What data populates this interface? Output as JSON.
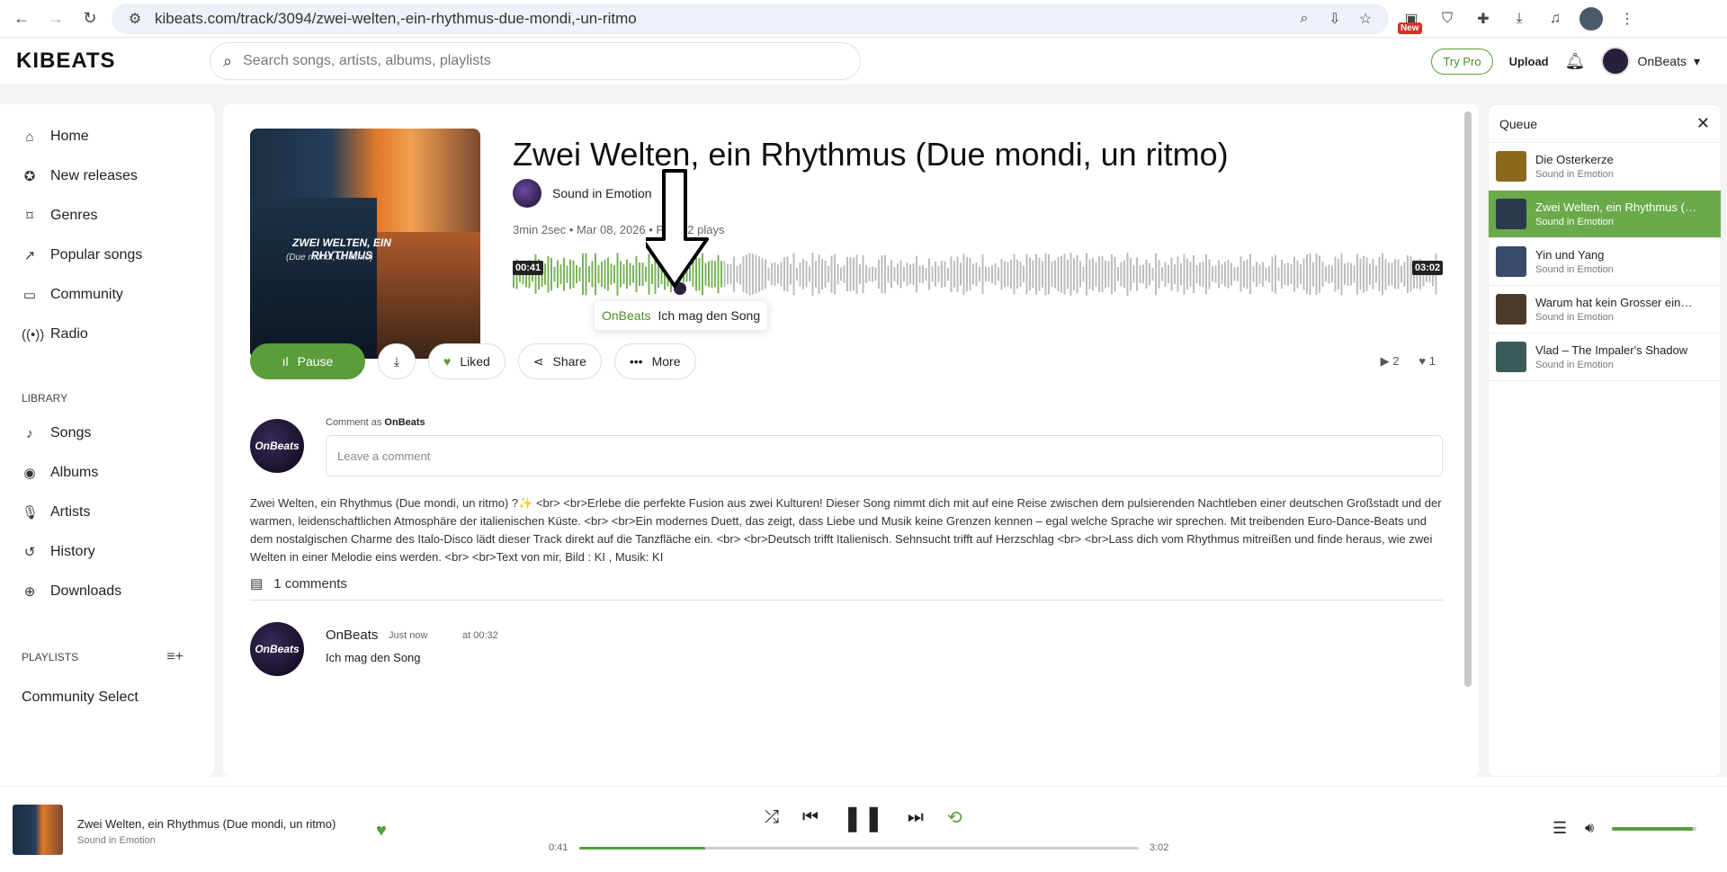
{
  "browser": {
    "url": "kibeats.com/track/3094/zwei-welten,-ein-rhythmus-due-mondi,-un-ritmo",
    "new_badge": "New"
  },
  "header": {
    "logo": "KIBEATS",
    "search_placeholder": "Search songs, artists, albums, playlists",
    "try_pro": "Try Pro",
    "upload": "Upload",
    "user": "OnBeats"
  },
  "sidebar": {
    "items": [
      {
        "label": "Home",
        "icon": "home-icon"
      },
      {
        "label": "New releases",
        "icon": "badge-icon"
      },
      {
        "label": "Genres",
        "icon": "tag-icon"
      },
      {
        "label": "Popular songs",
        "icon": "trend-icon"
      },
      {
        "label": "Community",
        "icon": "chat-icon"
      },
      {
        "label": "Radio",
        "icon": "radio-icon"
      }
    ],
    "library_title": "LIBRARY",
    "library": [
      {
        "label": "Songs",
        "icon": "note-icon"
      },
      {
        "label": "Albums",
        "icon": "disc-icon"
      },
      {
        "label": "Artists",
        "icon": "mic-icon"
      },
      {
        "label": "History",
        "icon": "history-icon"
      },
      {
        "label": "Downloads",
        "icon": "download-icon"
      }
    ],
    "playlists_title": "PLAYLISTS",
    "playlist": "Community Select"
  },
  "track": {
    "title": "Zwei Welten, ein Rhythmus (Due mondi, un ritmo)",
    "artist": "Sound in Emotion",
    "meta": "3min 2sec • Mar 08, 2026 • Pop • 2 plays",
    "cover_title": "ZWEI WELTEN, EIN RHYTHMUS",
    "cover_subtitle": "(Due mondi, un ritmo)",
    "time_start": "00:41",
    "time_end": "03:02",
    "progress": 0.225,
    "tooltip_user": "OnBeats",
    "tooltip_text": "Ich mag den Song"
  },
  "actions": {
    "pause": "Pause",
    "liked": "Liked",
    "share": "Share",
    "more": "More",
    "plays": "2",
    "likes": "1"
  },
  "comment_form": {
    "label": "Comment as",
    "user": "OnBeats",
    "placeholder": "Leave a comment",
    "avatar_text": "OnBeats"
  },
  "description": "Zwei Welten, ein Rhythmus (Due mondi, un ritmo) ?✨ <br> <br>Erlebe die perfekte Fusion aus zwei Kulturen! Dieser Song nimmt dich mit auf eine Reise zwischen dem pulsierenden Nachtleben einer deutschen Großstadt und der warmen, leidenschaftlichen Atmosphäre der italienischen Küste. <br> <br>Ein modernes Duett, das zeigt, dass Liebe und Musik keine Grenzen kennen – egal welche Sprache wir sprechen. Mit treibenden Euro-Dance-Beats und dem nostalgischen Charme des Italo-Disco lädt dieser Track direkt auf die Tanzfläche ein. <br> <br>Deutsch trifft Italienisch. Sehnsucht trifft auf Herzschlag <br> <br>Lass dich vom Rhythmus mitreißen und finde heraus, wie zwei Welten in einer Melodie eins werden. <br> <br>Text von mir, Bild : KI , Musik: KI",
  "comments": {
    "count_label": "1 comments",
    "items": [
      {
        "name": "OnBeats",
        "when": "Just now",
        "at": "at 00:32",
        "text": "Ich mag den Song"
      }
    ]
  },
  "queue": {
    "title": "Queue",
    "items": [
      {
        "title": "Die Osterkerze",
        "artist": "Sound in Emotion",
        "color": "#8a6a1a"
      },
      {
        "title": "Zwei Welten, ein Rhythmus (Due mondi, un ritmo)",
        "artist": "Sound in Emotion",
        "color": "#2a3a4a"
      },
      {
        "title": "Yin und Yang",
        "artist": "Sound in Emotion",
        "color": "#3a4a6a"
      },
      {
        "title": "Warum hat kein Grosser einen Plan",
        "artist": "Sound in Emotion",
        "color": "#4a3a2a"
      },
      {
        "title": "Vlad – The Impaler's Shadow",
        "artist": "Sound in Emotion",
        "color": "#3a5a5a"
      }
    ]
  },
  "player": {
    "title": "Zwei Welten, ein Rhythmus (Due mondi, un ritmo)",
    "artist": "Sound in Emotion",
    "current": "0:41",
    "total": "3:02",
    "progress": 0.225,
    "volume": 0.95
  },
  "colors": {
    "accent": "#5a9d3a"
  }
}
